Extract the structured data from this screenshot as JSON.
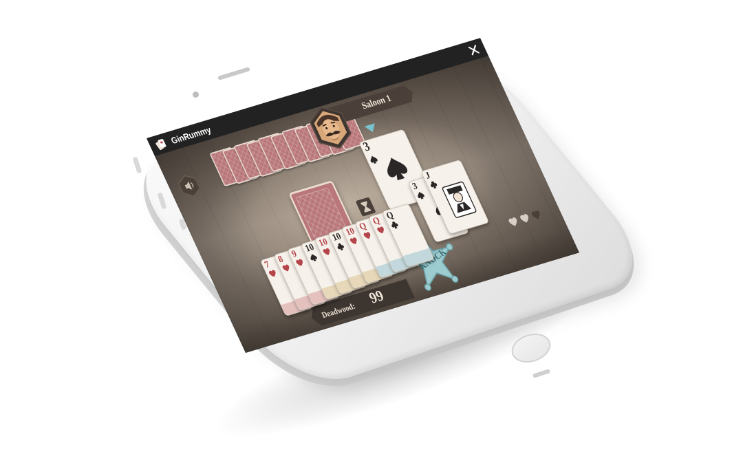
{
  "app": {
    "title": "GinRummy",
    "close_icon": "close-icon",
    "app_icon": "cards-icon"
  },
  "table": {
    "name": "Saloon 1",
    "opponent_avatar": "cowboy-avatar",
    "sound_icon": "speaker-icon",
    "timer_icon": "hourglass-icon",
    "discard_indicator_icon": "triangle-down-icon",
    "opponent_card_count": 11
  },
  "discard_pile": {
    "rank": "3",
    "suit": "spade",
    "color": "black"
  },
  "hand": [
    {
      "rank": "7",
      "suit": "heart",
      "color": "red",
      "meld": "red"
    },
    {
      "rank": "8",
      "suit": "heart",
      "color": "red",
      "meld": "red"
    },
    {
      "rank": "9",
      "suit": "heart",
      "color": "red",
      "meld": "red"
    },
    {
      "rank": "10",
      "suit": "spade",
      "color": "black",
      "meld": "tan"
    },
    {
      "rank": "10",
      "suit": "heart",
      "color": "red",
      "meld": "tan"
    },
    {
      "rank": "10",
      "suit": "club",
      "color": "black",
      "meld": "tan"
    },
    {
      "rank": "10",
      "suit": "heart",
      "color": "red",
      "meld": "tan"
    },
    {
      "rank": "Q",
      "suit": "heart",
      "color": "red",
      "meld": "blue"
    },
    {
      "rank": "Q",
      "suit": "heart",
      "color": "red",
      "meld": "blue"
    },
    {
      "rank": "Q",
      "suit": "club",
      "color": "black",
      "meld": "blue"
    },
    {
      "rank": "3",
      "suit": "spade",
      "color": "black",
      "meld": "none"
    },
    {
      "rank": "J",
      "suit": "club",
      "color": "black",
      "meld": "none"
    }
  ],
  "status": {
    "deadwood_label": "Deadwood:",
    "deadwood_value": "99",
    "knock_label": "KNOCK",
    "lives_total": 3,
    "lives_remaining": 0
  },
  "colors": {
    "felt": "#7d7166",
    "card_back": "#b9777a",
    "titlebar": "#222222",
    "knock_badge": "#9ccbd0",
    "suit_red": "#b4454b",
    "suit_black": "#2b2726"
  }
}
